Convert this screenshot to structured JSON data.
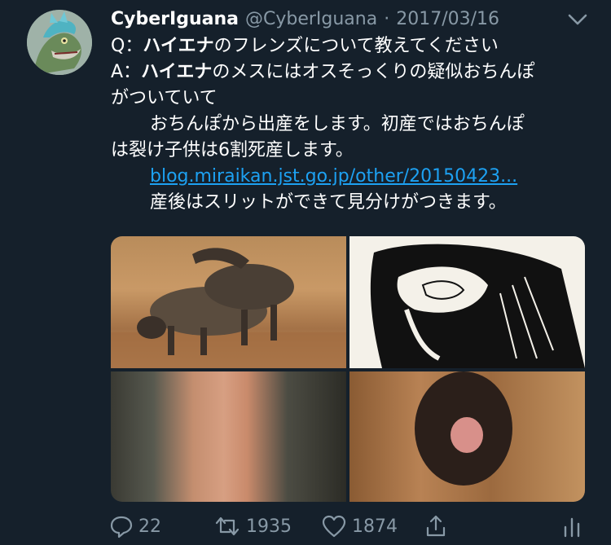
{
  "tweet": {
    "display_name": "CyberIguana",
    "handle": "@CyberIguana",
    "separator": "·",
    "date": "2017/03/16",
    "lines": [
      {
        "pre": "Q：",
        "bold": "ハイエナ",
        "post": "のフレンズについて教えてください"
      },
      {
        "pre": "A：",
        "bold": "ハイエナ",
        "post": "のメスにはオスそっくりの疑似おちんぽ"
      }
    ],
    "line3": "がついていて",
    "line4": "おちんぽから出産をします。初産ではおちんぽ",
    "line5": "は裂け子供は6割死産します。",
    "link_text": "blog.miraikan.jst.go.jp/other/20150423...",
    "line7": "産後はスリットができて見分けがつきます。"
  },
  "actions": {
    "reply_count": "22",
    "retweet_count": "1935",
    "like_count": "1874"
  },
  "colors": {
    "background": "#15202b",
    "text": "#ffffff",
    "secondary": "#8899a6",
    "link": "#1da1f2"
  },
  "icons": [
    "chevron-down-icon",
    "reply-icon",
    "retweet-icon",
    "like-icon",
    "share-icon",
    "analytics-icon"
  ]
}
